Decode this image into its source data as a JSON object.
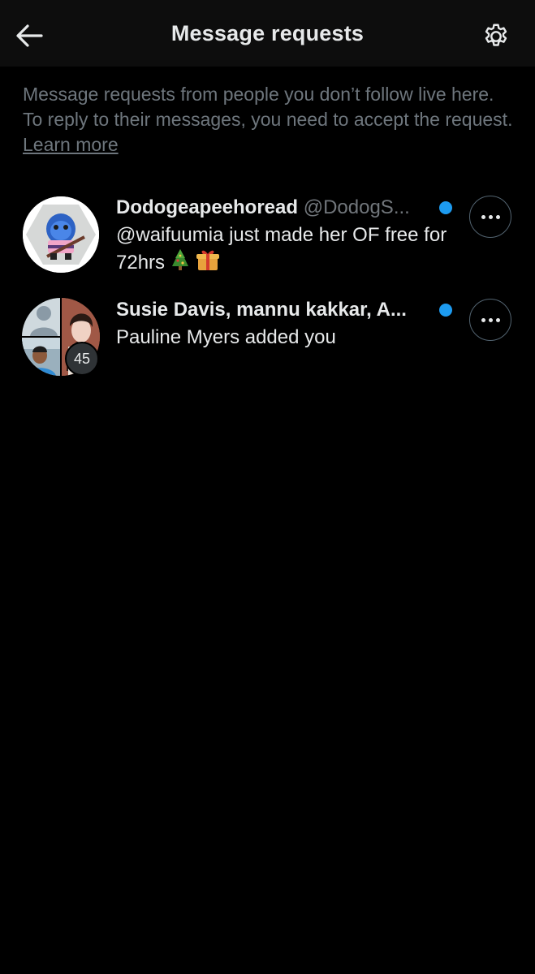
{
  "header": {
    "title": "Message requests",
    "back_icon": "arrow-left-icon",
    "settings_icon": "gear-icon"
  },
  "info": {
    "text": "Message requests from people you don’t follow live here. To reply to their messages, you need to accept the request. ",
    "link_label": "Learn more"
  },
  "requests": [
    {
      "name": "Dodogeapeehoread",
      "handle": "@DodogS...",
      "message": "@waifuumia just made her OF free for 72hrs",
      "emojis": [
        "christmas-tree-icon",
        "gift-icon"
      ],
      "unread": true
    },
    {
      "name": "Susie Davis, mannu kakkar, A...",
      "message": "Pauline Myers added you",
      "participant_count": "45",
      "unread": true
    }
  ],
  "colors": {
    "background": "#000000",
    "header_background": "#0d0d0d",
    "text_primary": "#e7e9ea",
    "text_secondary": "#6e767d",
    "accent": "#1d9bf0"
  }
}
